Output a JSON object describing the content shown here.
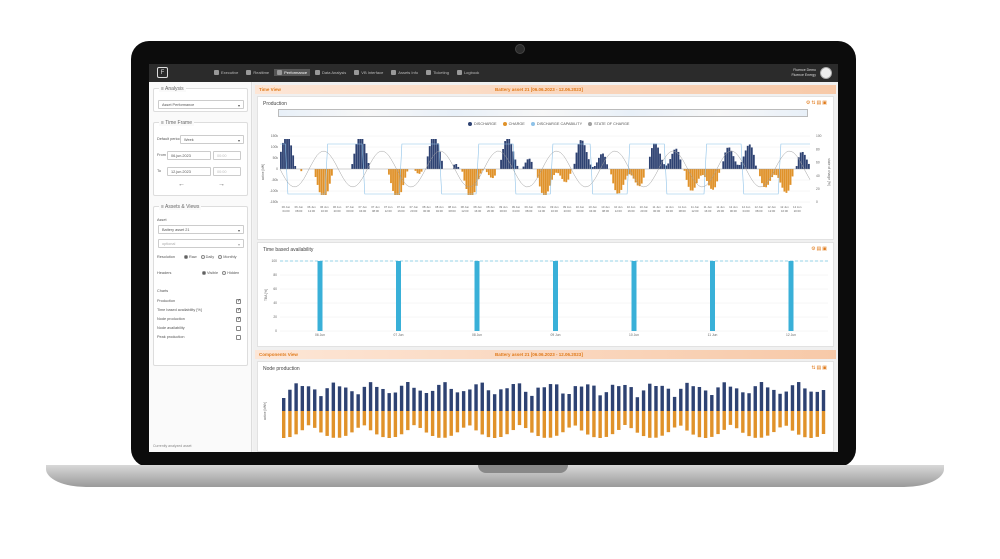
{
  "topbar": {
    "logo": "F",
    "nav": [
      {
        "label": "Executive",
        "active": false
      },
      {
        "label": "Realtime",
        "active": false
      },
      {
        "label": "Performance",
        "active": true
      },
      {
        "label": "Data Analysis",
        "active": false
      },
      {
        "label": "VB Interface",
        "active": false
      },
      {
        "label": "Assets Info",
        "active": false
      },
      {
        "label": "Ticketing",
        "active": false
      },
      {
        "label": "Logbook",
        "active": false
      }
    ],
    "user_name": "Fluence Demo",
    "user_company": "Fluence Energy"
  },
  "sidebar": {
    "analysis_title": "Analysis",
    "analysis_select": "Asset Performance",
    "timeframe_title": "Time Frame",
    "default_period_label": "Default period",
    "default_period_value": "Week",
    "from_label": "From",
    "from_date": "06.jun.2023",
    "from_time": "00:00",
    "to_label": "To",
    "to_date": "12.jun.2023",
    "to_time": "00:00",
    "prev_arrow": "←",
    "next_arrow": "→",
    "assets_title": "Assets & Views",
    "asset_label": "Asset",
    "asset_value": "Battery asset 21",
    "optional_value": "optional",
    "resolution_label": "Resolution",
    "resolution_options": [
      "Raw",
      "Daily",
      "Monthly"
    ],
    "headers_label": "Headers",
    "headers_options": [
      "Visible",
      "Hidden"
    ],
    "charts_label": "Charts",
    "charts": [
      {
        "label": "Production",
        "checked": true
      },
      {
        "label": "Time based availability [%]",
        "checked": true
      },
      {
        "label": "Node production",
        "checked": true
      },
      {
        "label": "Node availability",
        "checked": false
      },
      {
        "label": "Peak production",
        "checked": false
      }
    ],
    "footer": "Currently analyzed asset"
  },
  "time_view": {
    "left": "Time View",
    "center": "Battery asset 21 [06.06.2023 - 12.06.2023]"
  },
  "production": {
    "title": "Production",
    "legend": [
      "DISCHARGE",
      "CHARGE",
      "DISCHARGE CAPABILITY",
      "STATE OF CHARGE"
    ],
    "colors": {
      "discharge": "#2e4272",
      "charge": "#e0922a",
      "capability": "#8ec2e8",
      "soc": "#a0a0a0"
    },
    "y_ticks": [
      "150k",
      "100k",
      "50k",
      "0",
      "-50k",
      "-100k",
      "-150k"
    ],
    "y2_ticks": [
      "100",
      "80",
      "60",
      "40",
      "20",
      "0"
    ],
    "y_label": "active [kW]",
    "y2_label": "state of charge [%]",
    "x_ticks": [
      "06 Jun 04:00",
      "06 Jun 08:00",
      "06 Jun 12:00",
      "06 Jun 16:00",
      "06 Jun 20:00",
      "07 Jun 00:00",
      "07 Jun 04:00",
      "07 Jun 08:00",
      "07 Jun 12:00",
      "07 Jun 16:00",
      "07 Jun 20:00",
      "08 Jun 00:00",
      "08 Jun 04:00",
      "08 Jun 08:00",
      "08 Jun 12:00",
      "08 Jun 16:00",
      "08 Jun 20:00",
      "09 Jun 00:00",
      "09 Jun 04:00",
      "09 Jun 08:00",
      "09 Jun 12:00",
      "09 Jun 16:00",
      "09 Jun 20:00",
      "10 Jun 00:00",
      "10 Jun 04:00",
      "10 Jun 08:00",
      "10 Jun 12:00",
      "10 Jun 16:00",
      "10 Jun 20:00",
      "11 Jun 00:00",
      "11 Jun 04:00",
      "11 Jun 08:00",
      "11 Jun 12:00",
      "11 Jun 16:00",
      "11 Jun 20:00",
      "12 Jun 00:00",
      "12 Jun 04:00",
      "12 Jun 08:00",
      "12 Jun 12:00",
      "12 Jun 16:00",
      "12 Jun 20:00"
    ]
  },
  "availability": {
    "title": "Time based availability",
    "y_label": "TBA [%]",
    "y_ticks": [
      "100",
      "80",
      "60",
      "40",
      "20",
      "0"
    ],
    "x_labels": [
      "06 Jun",
      "07 Jun",
      "08 Jun",
      "09 Jun",
      "10 Jun",
      "11 Jun",
      "12 Jun"
    ],
    "values": [
      100,
      100,
      100,
      100,
      100,
      100,
      100
    ],
    "bar_color": "#39b0d8"
  },
  "components_view": {
    "left": "Components View",
    "center": "Battery asset 21 [06.06.2023 - 12.06.2023]"
  },
  "node_production": {
    "title": "Node production",
    "y_label": "active [kWh]"
  }
}
